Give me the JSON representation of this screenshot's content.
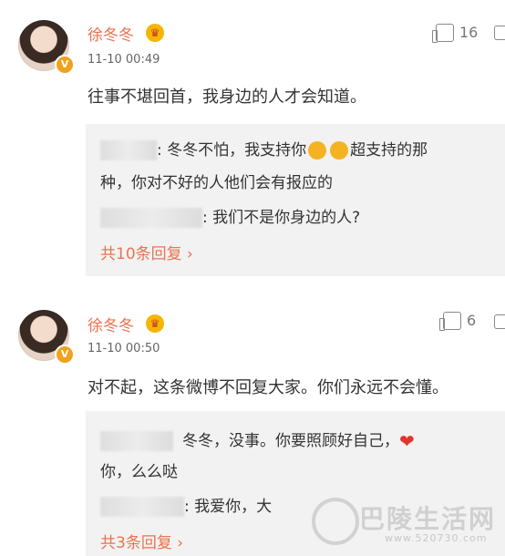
{
  "comments": [
    {
      "author": "徐冬冬",
      "time": "11-10 00:49",
      "likes": "16",
      "text": "往事不堪回首，我身边的人才会知道。",
      "replies": [
        {
          "line1": ": 冬冬不怕，我支持你",
          "line1b": "超支持的那",
          "line2": "种，你对不好的人他们会有报应的"
        },
        {
          "line1": ": 我们不是你身边的人?"
        }
      ],
      "more": "共10条回复 ›"
    },
    {
      "author": "徐冬冬",
      "time": "11-10 00:50",
      "likes": "6",
      "text": "对不起，这条微博不回复大家。你们永远不会懂。",
      "replies": [
        {
          "line1": "冬冬，没事。你要照顾好自己，",
          "line2": "你，么么哒"
        },
        {
          "line1": ": 我爱你，大"
        }
      ],
      "more": "共3条回复 ›"
    }
  ],
  "watermark": {
    "text": "巴陵生活网",
    "url": "www.520730.com"
  },
  "colors": {
    "accent": "#eb7350",
    "reply_bg": "#f2f2f2"
  }
}
